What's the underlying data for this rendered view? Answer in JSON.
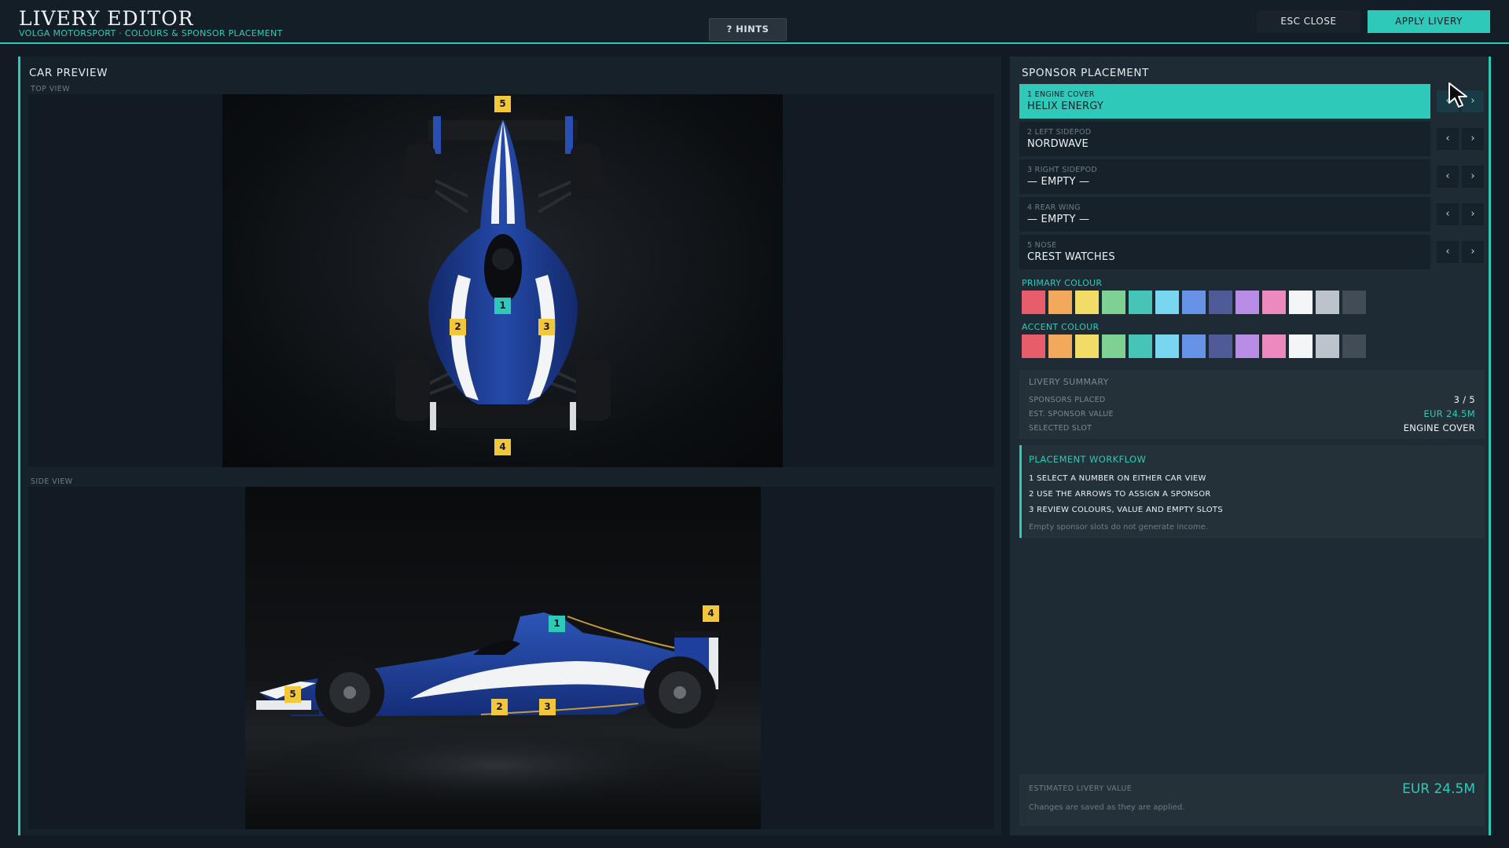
{
  "header": {
    "title": "LIVERY EDITOR",
    "subtitle": "VOLGA MOTORSPORT  ·  COLOURS & SPONSOR PLACEMENT",
    "hints_label": "? HINTS",
    "close_label": "ESC CLOSE",
    "apply_label": "APPLY LIVERY"
  },
  "preview": {
    "title": "CAR PREVIEW",
    "top_view_label": "TOP VIEW",
    "side_view_label": "SIDE VIEW",
    "top_markers": [
      "5",
      "1",
      "2",
      "3",
      "4"
    ],
    "side_markers": [
      "1",
      "4",
      "5",
      "2",
      "3"
    ]
  },
  "sponsor": {
    "title": "SPONSOR PLACEMENT",
    "slots": [
      {
        "label": "1  ENGINE COVER",
        "value": "HELIX ENERGY",
        "selected": true
      },
      {
        "label": "2  LEFT SIDEPOD",
        "value": "NORDWAVE",
        "selected": false
      },
      {
        "label": "3  RIGHT SIDEPOD",
        "value": "— EMPTY —",
        "selected": false
      },
      {
        "label": "4  REAR WING",
        "value": "— EMPTY —",
        "selected": false
      },
      {
        "label": "5  NOSE",
        "value": "CREST WATCHES",
        "selected": false
      }
    ],
    "prev_arrow": "‹",
    "next_arrow": "›"
  },
  "colours": {
    "primary_label": "PRIMARY COLOUR",
    "accent_label": "ACCENT COLOUR",
    "palette": [
      "#e85d6b",
      "#f2a95b",
      "#f2dc68",
      "#7fd193",
      "#46c4b5",
      "#79d6f0",
      "#6693e6",
      "#4f5b96",
      "#b98ce6",
      "#ec8ac0",
      "#f4f5f7",
      "#bcc3ca",
      "#424c56"
    ]
  },
  "summary": {
    "title": "LIVERY SUMMARY",
    "rows": [
      {
        "key": "SPONSORS PLACED",
        "value": "3 / 5"
      },
      {
        "key": "EST. SPONSOR VALUE",
        "value": "EUR 24.5M"
      },
      {
        "key": "SELECTED SLOT",
        "value": "ENGINE COVER"
      }
    ]
  },
  "workflow": {
    "title": "PLACEMENT WORKFLOW",
    "steps": [
      "1  SELECT A NUMBER ON EITHER CAR VIEW",
      "2  USE THE ARROWS TO ASSIGN A SPONSOR",
      "3  REVIEW COLOURS, VALUE AND EMPTY SLOTS"
    ],
    "note": "Empty sponsor slots do not generate income."
  },
  "footer": {
    "label": "ESTIMATED LIVERY VALUE",
    "note": "Changes are saved as they are applied.",
    "value": "EUR 24.5M"
  },
  "theme": {
    "accent": "#2ec9b9",
    "marker": "#f2c73b",
    "car_blue": "#1d3c96"
  }
}
